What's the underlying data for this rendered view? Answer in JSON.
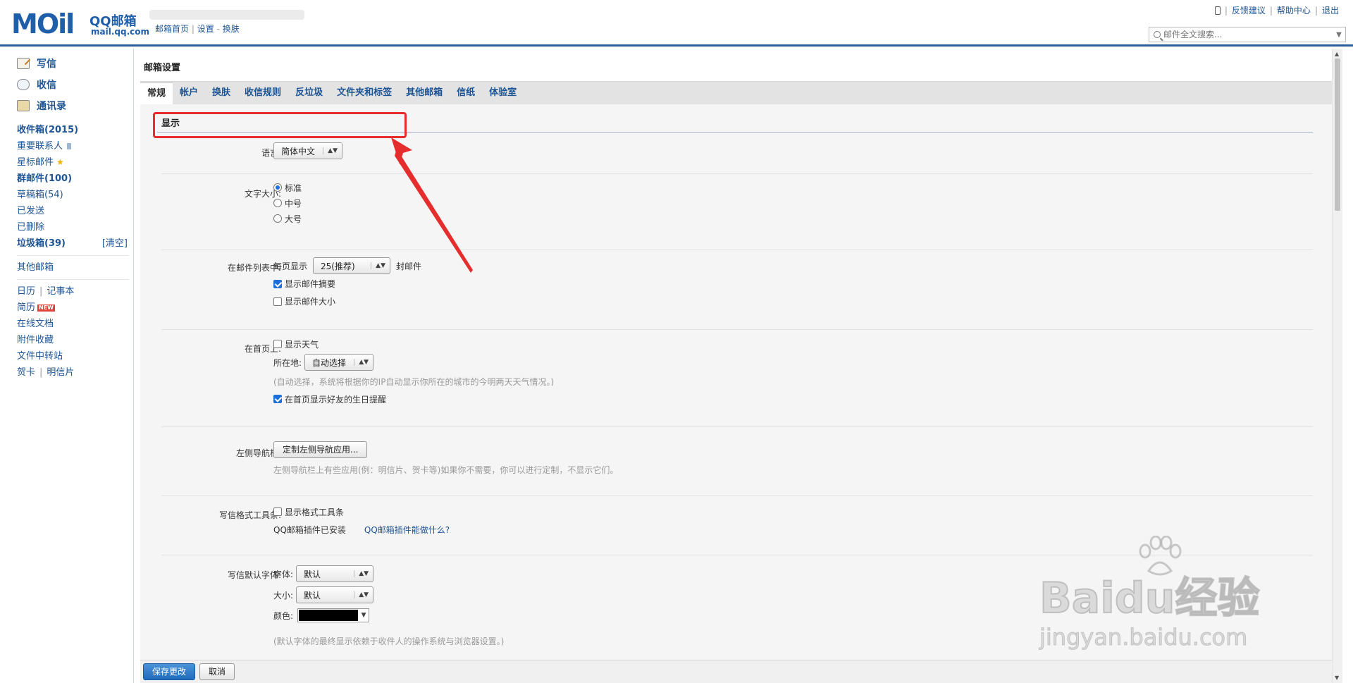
{
  "header": {
    "logo_text": "MOil",
    "logo_cn": "QQ邮箱",
    "logo_url": "mail.qq.com",
    "home_link": "邮箱首页",
    "settings_link": "设置",
    "skin_link": "换肤",
    "top_links": [
      "反馈建议",
      "帮助中心",
      "退出"
    ],
    "search_placeholder": "邮件全文搜索..."
  },
  "sidebar": {
    "compose": "写信",
    "receive": "收信",
    "contacts": "通讯录",
    "folders": [
      {
        "label": "收件箱(2015)",
        "bold": true
      },
      {
        "label": "重要联系人",
        "bold": false
      },
      {
        "label": "星标邮件",
        "bold": false
      },
      {
        "label": "群邮件(100)",
        "bold": true
      },
      {
        "label": "草稿箱(54)",
        "bold": false
      },
      {
        "label": "已发送",
        "bold": false
      },
      {
        "label": "已删除",
        "bold": false
      },
      {
        "label": "垃圾箱(39)",
        "bold": true
      }
    ],
    "clear_label": "[清空]",
    "other_mail": "其他邮箱",
    "calendar": "日历",
    "notepad": "记事本",
    "resume": "简历",
    "new_badge": "NEW",
    "online_docs": "在线文档",
    "attachments": "附件收藏",
    "file_transfer": "文件中转站",
    "greeting_card": "贺卡",
    "postcard": "明信片"
  },
  "main": {
    "title": "邮箱设置",
    "tabs": [
      "常规",
      "帐户",
      "换肤",
      "收信规则",
      "反垃圾",
      "文件夹和标签",
      "其他邮箱",
      "信纸",
      "体验室"
    ],
    "section_title": "显示",
    "language": {
      "label": "语言:",
      "value": "简体中文"
    },
    "font_size": {
      "label": "文字大小:",
      "options": [
        "标准",
        "中号",
        "大号"
      ]
    },
    "mail_list": {
      "label": "在邮件列表中:",
      "per_page_prefix": "每页显示",
      "per_page_value": "25(推荐)",
      "per_page_suffix": "封邮件",
      "show_summary": "显示邮件摘要",
      "show_size": "显示邮件大小"
    },
    "homepage": {
      "label": "在首页上:",
      "show_weather": "显示天气",
      "location_label": "所在地:",
      "location_value": "自动选择",
      "location_hint": "(自动选择，系统将根据你的IP自动显示你所在的城市的今明两天天气情况。)",
      "birthday": "在首页显示好友的生日提醒"
    },
    "left_nav": {
      "label": "左侧导航栏:",
      "button": "定制左侧导航应用...",
      "hint": "左侧导航栏上有些应用(例：明信片、贺卡等)如果你不需要，你可以进行定制，不显示它们。"
    },
    "format_toolbar": {
      "label": "写信格式工具条:",
      "show": "显示格式工具条",
      "plugin_installed": "QQ邮箱插件已安装",
      "plugin_link": "QQ邮箱插件能做什么?"
    },
    "default_font": {
      "label": "写信默认字体:",
      "font_label": "字体:",
      "font_value": "默认",
      "size_label": "大小:",
      "size_value": "默认",
      "color_label": "颜色:",
      "color_value": "#000000",
      "hint": "(默认字体的最终显示依赖于收件人的操作系统与浏览器设置。)"
    },
    "save_button": "保存更改",
    "cancel_button": "取消"
  },
  "watermark": {
    "brand": "Bai",
    "brand2": "du",
    "brand_cn": "经验",
    "url": "jingyan.baidu.com"
  },
  "colors": {
    "accent": "#1d5494",
    "header_border": "#2a5d9a",
    "highlight": "#e52d2d"
  }
}
